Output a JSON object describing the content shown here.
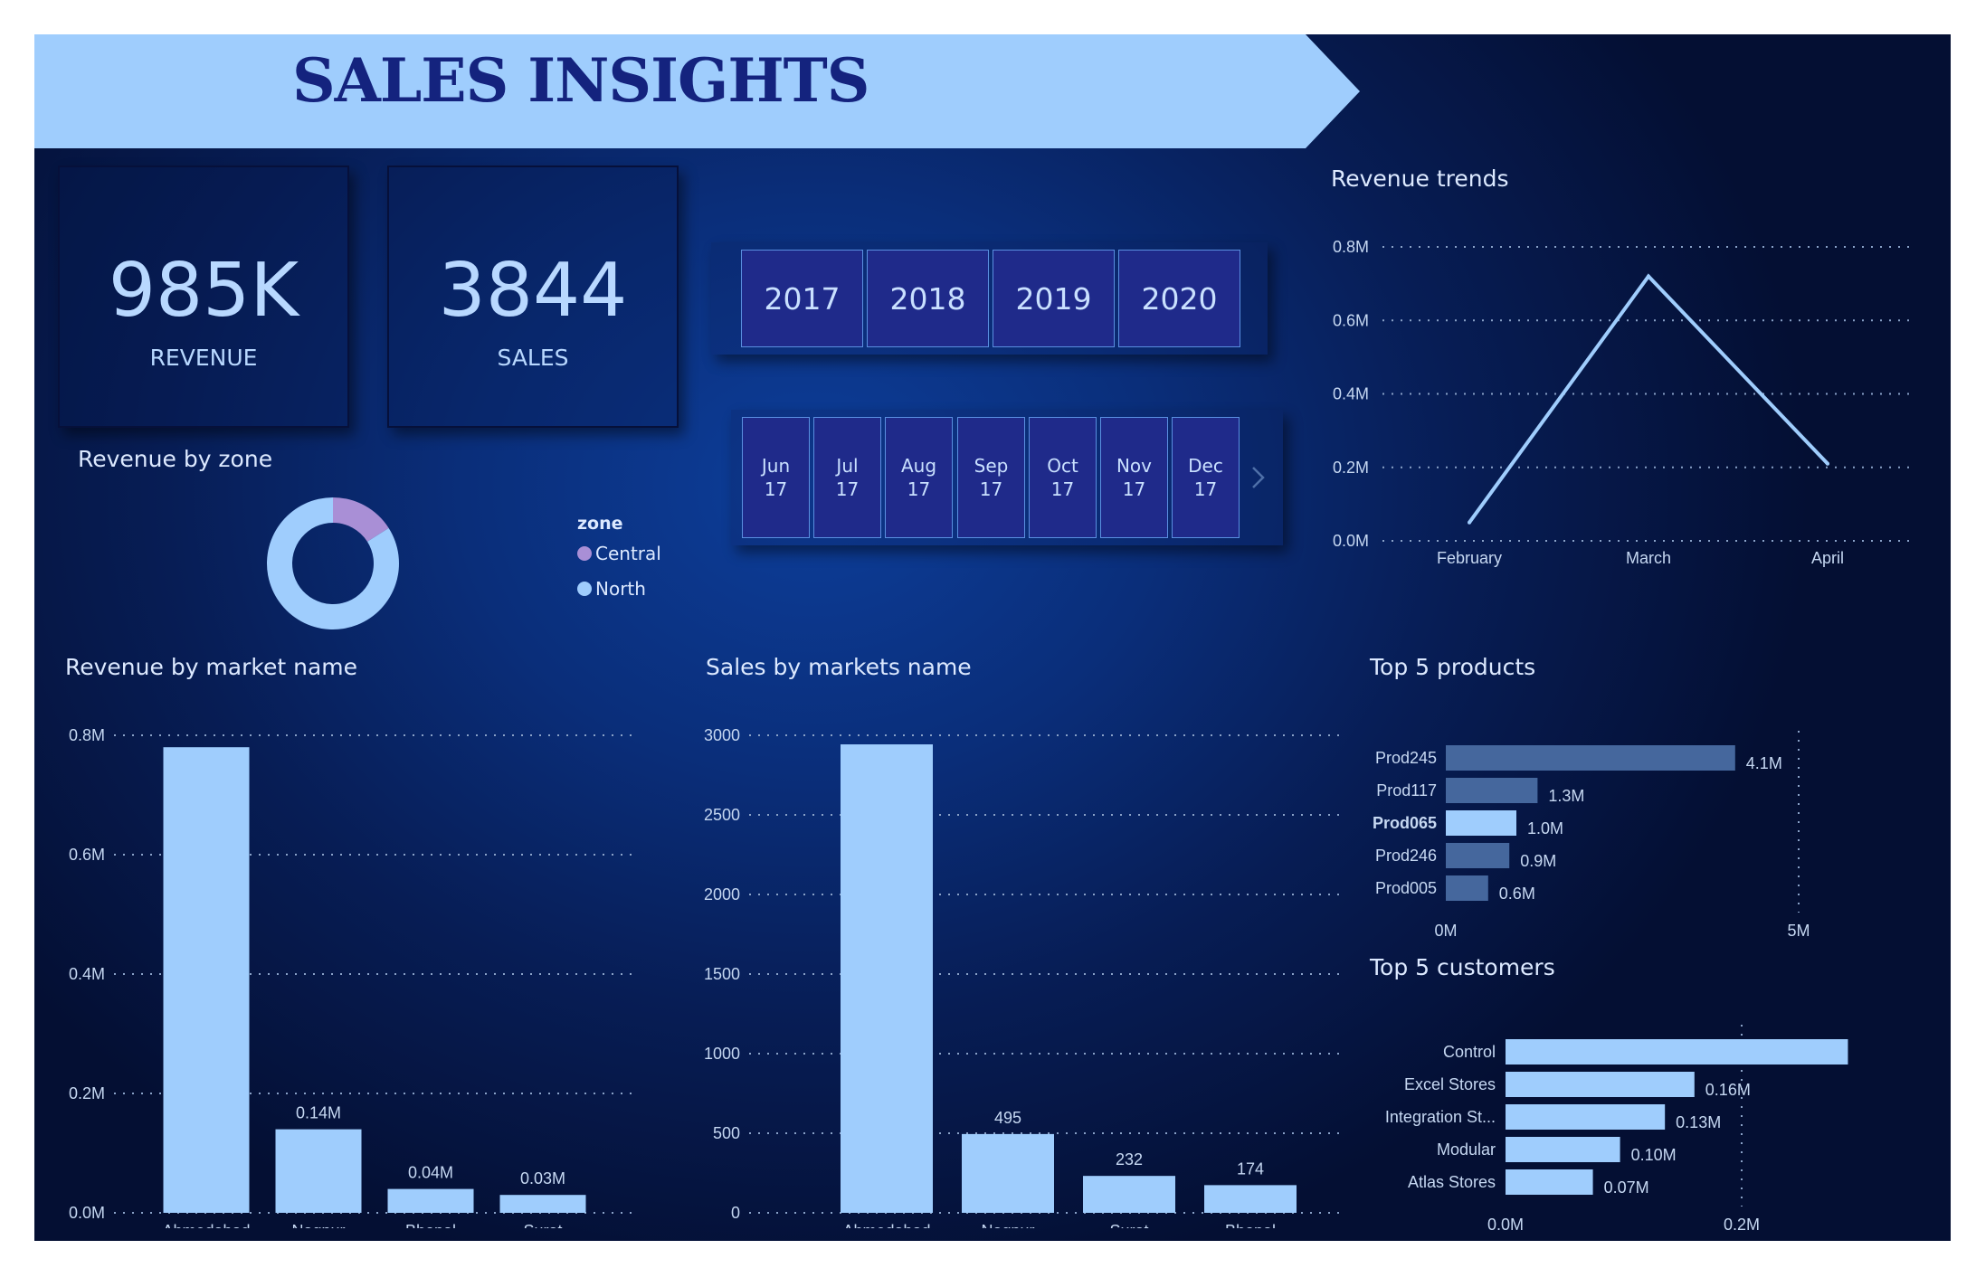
{
  "header": {
    "title": "SALES INSIGHTS"
  },
  "kpis": [
    {
      "value": "985K",
      "label": "REVENUE"
    },
    {
      "value": "3844",
      "label": "SALES"
    }
  ],
  "year_slicer": [
    "2017",
    "2018",
    "2019",
    "2020"
  ],
  "month_slicer": [
    {
      "month": "Jun",
      "year": "17"
    },
    {
      "month": "Jul",
      "year": "17"
    },
    {
      "month": "Aug",
      "year": "17"
    },
    {
      "month": "Sep",
      "year": "17"
    },
    {
      "month": "Oct",
      "year": "17"
    },
    {
      "month": "Nov",
      "year": "17"
    },
    {
      "month": "Dec",
      "year": "17"
    }
  ],
  "colors": {
    "banner": "#9fcdfd",
    "bar": "#9fcdfd",
    "line": "#9fcdfd",
    "central": "#a98fd6",
    "north": "#9fcdfd",
    "top_product": "#9fcdfd",
    "product_dim": [
      "#45679d",
      "#45679d",
      "#9fcdfd",
      "#45679d",
      "#45679d"
    ]
  },
  "chart_data": [
    {
      "id": "revenue_trends",
      "type": "line",
      "title": "Revenue trends",
      "categories": [
        "February",
        "March",
        "April"
      ],
      "values": [
        0.05,
        0.72,
        0.21
      ],
      "yticks": [
        "0.0M",
        "0.2M",
        "0.4M",
        "0.6M",
        "0.8M"
      ],
      "ylim": [
        0,
        0.8
      ],
      "grid": true
    },
    {
      "id": "revenue_by_zone",
      "type": "pie",
      "title": "Revenue by zone",
      "legend_title": "zone",
      "labels": [
        "Central",
        "North"
      ],
      "values": [
        0.16,
        0.84
      ]
    },
    {
      "id": "revenue_by_market",
      "type": "bar",
      "title": "Revenue by market name",
      "categories": [
        "Ahmedabad",
        "Nagpur",
        "Bhopal",
        "Surat"
      ],
      "values": [
        0.78,
        0.14,
        0.04,
        0.03
      ],
      "data_labels": [
        "",
        "0.14M",
        "0.04M",
        "0.03M"
      ],
      "yticks": [
        "0.0M",
        "0.2M",
        "0.4M",
        "0.6M",
        "0.8M"
      ],
      "ylim": [
        0,
        0.8
      ],
      "grid": true
    },
    {
      "id": "sales_by_market",
      "type": "bar",
      "title": "Sales by markets name",
      "categories": [
        "Ahmedabad",
        "Nagpur",
        "Surat",
        "Bhopal"
      ],
      "values": [
        2943,
        495,
        232,
        174
      ],
      "data_labels": [
        "",
        "495",
        "232",
        "174"
      ],
      "yticks": [
        "0",
        "500",
        "1000",
        "1500",
        "2000",
        "2500",
        "3000"
      ],
      "ylim": [
        0,
        3000
      ],
      "grid": true
    },
    {
      "id": "top_products",
      "type": "bar",
      "orientation": "horizontal",
      "title": "Top 5 products",
      "categories": [
        "Prod245",
        "Prod117",
        "Prod065",
        "Prod246",
        "Prod005"
      ],
      "values": [
        4.1,
        1.3,
        1.0,
        0.9,
        0.6
      ],
      "data_labels": [
        "4.1M",
        "1.3M",
        "1.0M",
        "0.9M",
        "0.6M"
      ],
      "xticks": [
        "0M",
        "5M"
      ],
      "xlim": [
        0,
        5
      ]
    },
    {
      "id": "top_customers",
      "type": "bar",
      "orientation": "horizontal",
      "title": "Top 5 customers",
      "categories": [
        "Control",
        "Excel Stores",
        "Integration St...",
        "Modular",
        "Atlas Stores"
      ],
      "values": [
        0.29,
        0.16,
        0.135,
        0.097,
        0.074
      ],
      "data_labels": [
        "",
        "0.16M",
        "0.13M",
        "0.10M",
        "0.07M"
      ],
      "xticks": [
        "0.0M",
        "0.2M"
      ],
      "xlim": [
        0,
        0.2
      ]
    }
  ]
}
